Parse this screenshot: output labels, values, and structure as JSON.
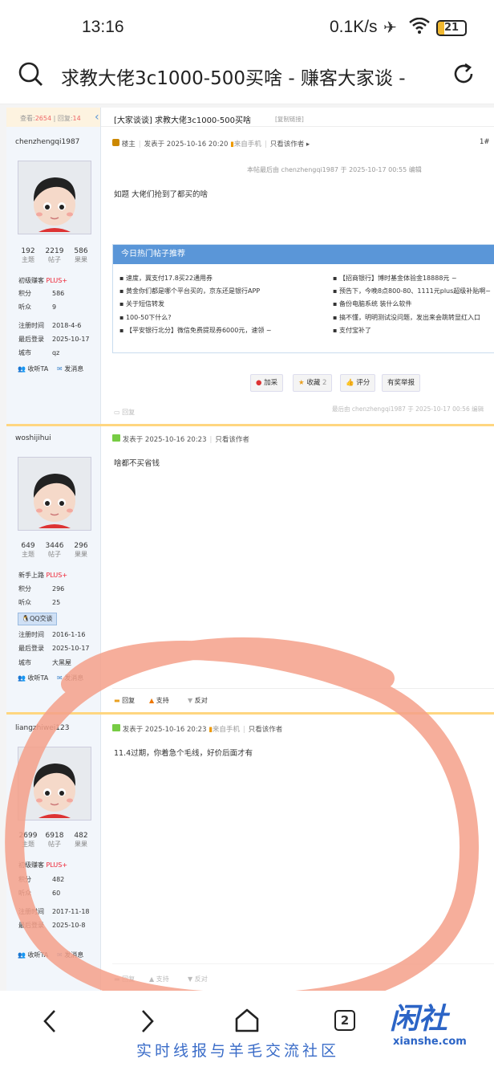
{
  "status_bar": {
    "time": "13:16",
    "net_speed": "0.1K/s",
    "battery": "21"
  },
  "browser": {
    "page_title": "求教大佬3c1000-500买啥 - 赚客大家谈 -"
  },
  "thread": {
    "views_label": "查看:",
    "views": "2654",
    "replies_label": "回复:",
    "replies": "14",
    "title": "[大家谈谈] 求教大佬3c1000-500买啥",
    "copy_link": "[复制链接]"
  },
  "posts": [
    {
      "author": "chenzhengqi1987",
      "stats": [
        {
          "value": "192",
          "label": "主题"
        },
        {
          "value": "2219",
          "label": "帖子"
        },
        {
          "value": "586",
          "label": "果果"
        }
      ],
      "rank": "初级赚客",
      "plus": "PLUS+",
      "fields": [
        {
          "k": "积分",
          "v": "586"
        },
        {
          "k": "听众",
          "v": "9"
        },
        {
          "k": "注册时间",
          "v": "2018-4-6"
        },
        {
          "k": "最后登录",
          "v": "2025-10-17"
        },
        {
          "k": "城市",
          "v": "qz"
        }
      ],
      "follow": "收听TA",
      "message": "发消息",
      "floor_label": "楼主",
      "posted": "发表于 2025-10-16 20:20",
      "device": "来自手机",
      "only_author": "只看该作者",
      "floor_num": "1#",
      "edited": "本帖最后由 chenzhengqi1987 于 2025-10-17 00:55 编辑",
      "content": "如题 大佬们抢到了都买的啥",
      "recommend_title": "今日热门帖子推荐",
      "recommend_left": [
        "速度，冀支付17.8买22通用券",
        "黄金你们都是哪个平台买的，京东还是银行APP",
        "关于短信转发",
        "100-50下什么?",
        "【平安银行北分】微信免费提现券6000元，速领 ~"
      ],
      "recommend_right": [
        "【招商银行】博时基金体验金18888元 ~",
        "预告下，今晚8点800-80、1111元plus超级补贴啊~",
        "备份电脑系统 装什么软件",
        "搞不懂，明明测试没问题，发出来会跳转显红入口",
        "支付宝补了"
      ],
      "actions": [
        "加采",
        "收藏",
        "评分",
        "有奖举报"
      ],
      "fav_count": "2",
      "reply_label": "回复",
      "last_reply": "最后由 chenzhengqi1987 于 2025-10-17 00:56 编辑"
    },
    {
      "author": "woshijihui",
      "stats": [
        {
          "value": "649",
          "label": "主题"
        },
        {
          "value": "3446",
          "label": "帖子"
        },
        {
          "value": "296",
          "label": "果果"
        }
      ],
      "rank": "新手上路",
      "plus": "PLUS+",
      "fields": [
        {
          "k": "积分",
          "v": "296"
        },
        {
          "k": "听众",
          "v": "25"
        },
        {
          "k": "注册时间",
          "v": "2016-1-16"
        },
        {
          "k": "最后登录",
          "v": "2025-10-17"
        },
        {
          "k": "城市",
          "v": "大黑屋"
        }
      ],
      "qq_badge": "QQ交谈",
      "follow": "收听TA",
      "message": "发消息",
      "posted": "发表于 2025-10-16 20:23",
      "only_author": "只看该作者",
      "content": "啥都不买省钱",
      "footer": [
        "回复",
        "支持",
        "反对"
      ]
    },
    {
      "author": "liangzhiwei123",
      "stats": [
        {
          "value": "2699",
          "label": "主题"
        },
        {
          "value": "6918",
          "label": "帖子"
        },
        {
          "value": "482",
          "label": "果果"
        }
      ],
      "rank": "初级赚客",
      "plus": "PLUS+",
      "fields": [
        {
          "k": "积分",
          "v": "482"
        },
        {
          "k": "听众",
          "v": "60"
        },
        {
          "k": "注册时间",
          "v": "2017-11-18"
        },
        {
          "k": "最后登录",
          "v": "2025-10-8"
        }
      ],
      "follow": "收听TA",
      "message": "发消息",
      "posted": "发表于 2025-10-16 20:23",
      "device": "来自手机",
      "only_author": "只看该作者",
      "content": "11.4过期，你着急个毛线，好价后面才有",
      "footer": [
        "回复",
        "支持",
        "反对"
      ]
    }
  ],
  "bottom_nav": {
    "tabs_count": "2",
    "slogan": "实时线报与羊毛交流社区",
    "logo": "闲社",
    "logo_domain": "xianshe.com"
  },
  "colors": {
    "accent": "#5a96d8",
    "annotation_circle": "#f4a08a",
    "plus": "#e23",
    "brand": "#2b64c6"
  }
}
